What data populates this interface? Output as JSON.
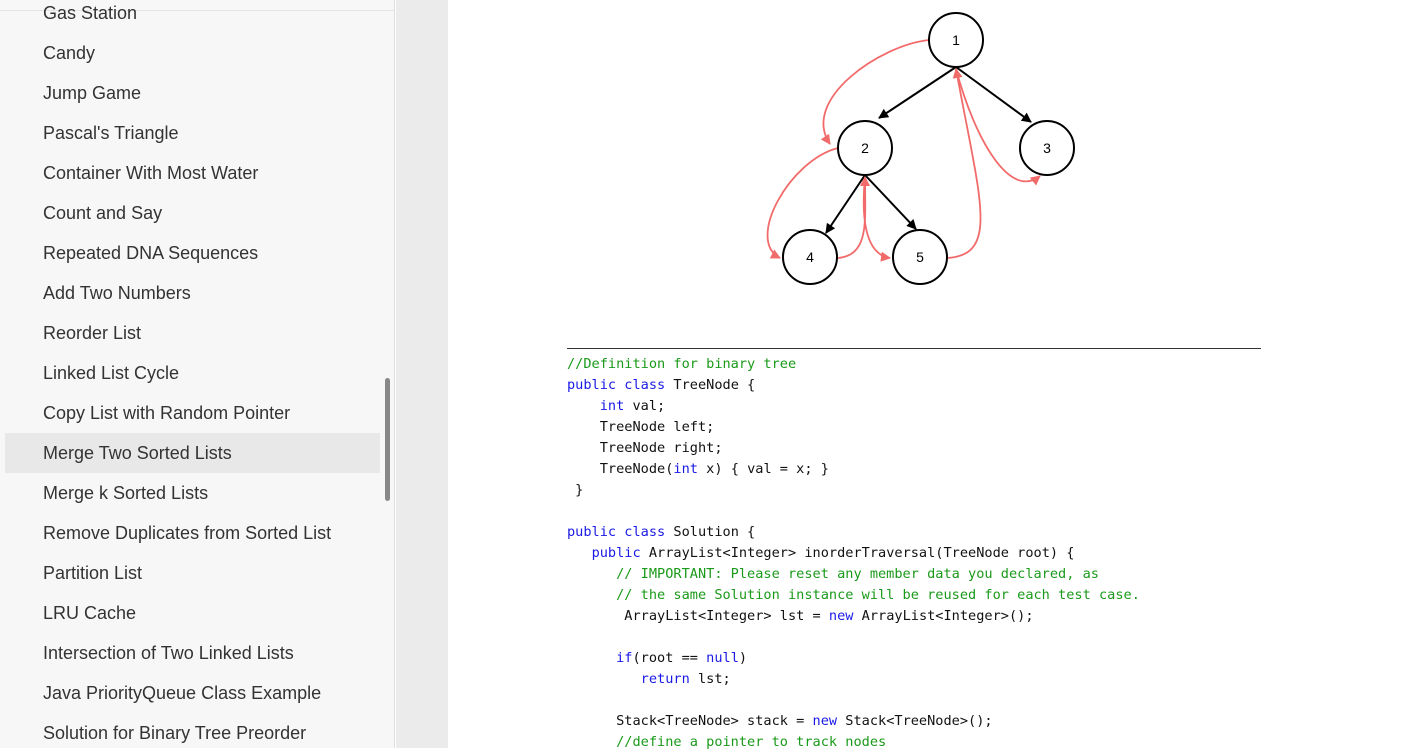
{
  "sidebar": {
    "items": [
      "Gas Station",
      "Candy",
      "Jump Game",
      "Pascal's Triangle",
      "Container With Most Water",
      "Count and Say",
      "Repeated DNA Sequences",
      "Add Two Numbers",
      "Reorder List",
      "Linked List Cycle",
      "Copy List with Random Pointer",
      "Merge Two Sorted Lists",
      "Merge k Sorted Lists",
      "Remove Duplicates from Sorted List",
      "Partition List",
      "LRU Cache",
      "Intersection of Two Linked Lists",
      "Java PriorityQueue Class Example",
      "Solution for Binary Tree Preorder"
    ],
    "active_index": 11
  },
  "tree": {
    "nodes": [
      "1",
      "2",
      "3",
      "4",
      "5"
    ],
    "edge_color": "#000000",
    "traversal_color": "#f26b6b"
  },
  "code": {
    "lines": [
      [
        [
          "c",
          "//Definition for binary tree"
        ]
      ],
      [
        [
          "k",
          "public class"
        ],
        [
          "t",
          " TreeNode {"
        ]
      ],
      [
        [
          "t",
          "    "
        ],
        [
          "k",
          "int"
        ],
        [
          "t",
          " val;"
        ]
      ],
      [
        [
          "t",
          "    TreeNode left;"
        ]
      ],
      [
        [
          "t",
          "    TreeNode right;"
        ]
      ],
      [
        [
          "t",
          "    TreeNode("
        ],
        [
          "k",
          "int"
        ],
        [
          "t",
          " x) { val = x; }"
        ]
      ],
      [
        [
          "t",
          " }"
        ]
      ],
      [
        [
          "t",
          ""
        ]
      ],
      [
        [
          "k",
          "public class"
        ],
        [
          "t",
          " Solution {"
        ]
      ],
      [
        [
          "t",
          "   "
        ],
        [
          "k",
          "public"
        ],
        [
          "t",
          " ArrayList<Integer> inorderTraversal(TreeNode root) {"
        ]
      ],
      [
        [
          "t",
          "      "
        ],
        [
          "c",
          "// IMPORTANT: Please reset any member data you declared, as"
        ]
      ],
      [
        [
          "t",
          "      "
        ],
        [
          "c",
          "// the same Solution instance will be reused for each test case."
        ]
      ],
      [
        [
          "t",
          "       ArrayList<Integer> lst = "
        ],
        [
          "k",
          "new"
        ],
        [
          "t",
          " ArrayList<Integer>();"
        ]
      ],
      [
        [
          "t",
          ""
        ]
      ],
      [
        [
          "t",
          "      "
        ],
        [
          "k",
          "if"
        ],
        [
          "t",
          "(root == "
        ],
        [
          "k",
          "null"
        ],
        [
          "t",
          ")"
        ]
      ],
      [
        [
          "t",
          "         "
        ],
        [
          "k",
          "return"
        ],
        [
          "t",
          " lst;"
        ]
      ],
      [
        [
          "t",
          ""
        ]
      ],
      [
        [
          "t",
          "      Stack<TreeNode> stack = "
        ],
        [
          "k",
          "new"
        ],
        [
          "t",
          " Stack<TreeNode>();"
        ]
      ],
      [
        [
          "t",
          "      "
        ],
        [
          "c",
          "//define a pointer to track nodes"
        ]
      ]
    ]
  }
}
